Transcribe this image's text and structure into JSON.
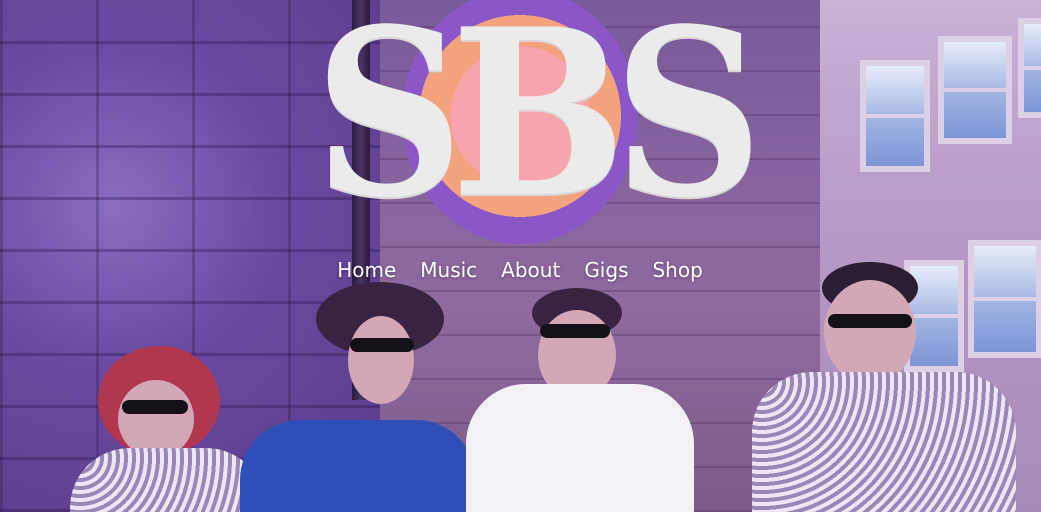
{
  "site": {
    "logo_text": "SBS"
  },
  "nav": {
    "items": [
      {
        "label": "Home"
      },
      {
        "label": "Music"
      },
      {
        "label": "About"
      },
      {
        "label": "Gigs"
      },
      {
        "label": "Shop"
      }
    ]
  },
  "theme": {
    "overlay": "#7a4fa8",
    "logo_fill": "#ecebeb",
    "logo_disc_outer": "#6a3aa8",
    "logo_disc_inner": "#f7a4ad",
    "nav_text": "#ffffff"
  }
}
